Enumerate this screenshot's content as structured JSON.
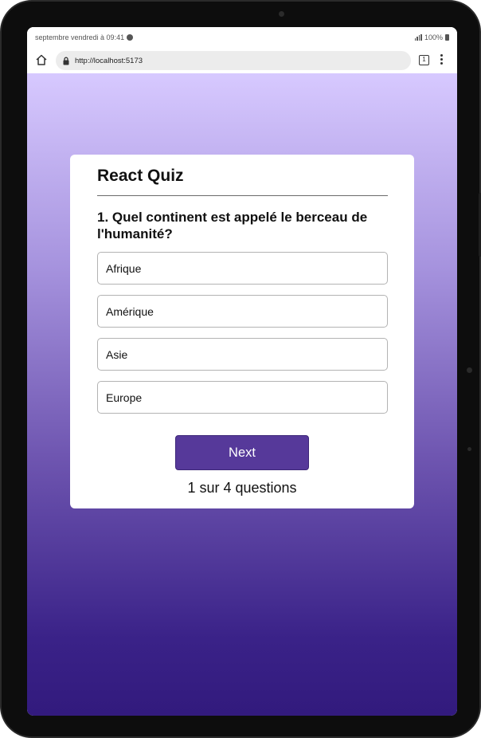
{
  "status_bar": {
    "date_time": "septembre vendredi à 09:41",
    "battery": "100%"
  },
  "browser": {
    "url": "http://localhost:5173",
    "tab_count": "1"
  },
  "quiz": {
    "title": "React Quiz",
    "question": "1. Quel continent est appelé le berceau de l'humanité?",
    "options": [
      "Afrique",
      "Amérique",
      "Asie",
      "Europe"
    ],
    "next_label": "Next",
    "progress": "1 sur 4 questions"
  },
  "colors": {
    "accent_button": "#56399a",
    "gradient_top": "#d7c9ff",
    "gradient_bottom": "#321a7d"
  }
}
